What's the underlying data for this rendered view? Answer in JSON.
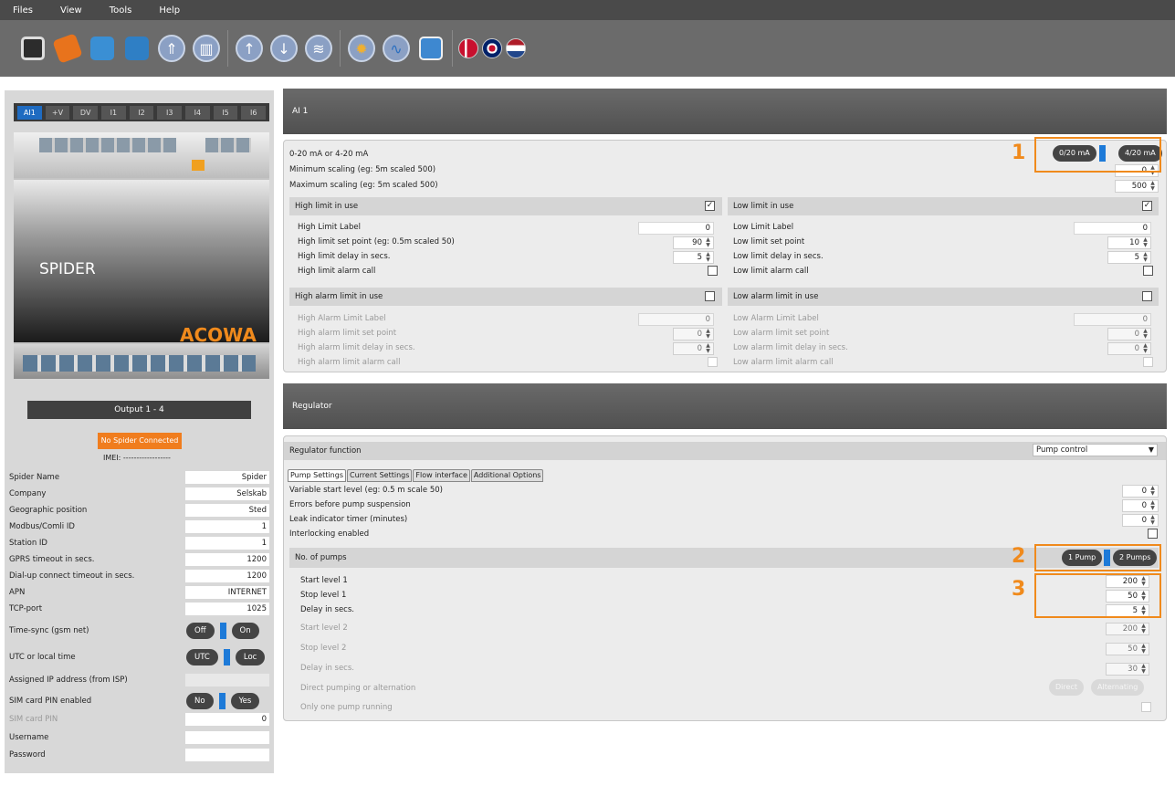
{
  "menu": [
    "Files",
    "View",
    "Tools",
    "Help"
  ],
  "ai_tabs": [
    "AI1",
    "+V",
    "DV",
    "I1",
    "I2",
    "I3",
    "I4",
    "I5",
    "I6"
  ],
  "device": {
    "brand": "SPIDER",
    "logo": "ACOWA"
  },
  "output_label": "Output 1 - 4",
  "status": "No Spider Connected",
  "imei": "IMEI: ------------------",
  "fields": [
    {
      "label": "Spider Name",
      "value": "Spider"
    },
    {
      "label": "Company",
      "value": "Selskab"
    },
    {
      "label": "Geographic position",
      "value": "Sted"
    },
    {
      "label": "Modbus/Comli ID",
      "value": "1"
    },
    {
      "label": "Station ID",
      "value": "1"
    },
    {
      "label": "GPRS timeout in secs.",
      "value": "1200"
    },
    {
      "label": "Dial-up connect timeout in secs.",
      "value": "1200"
    },
    {
      "label": "APN",
      "value": "INTERNET"
    },
    {
      "label": "TCP-port",
      "value": "1025"
    }
  ],
  "toggles": {
    "timesync": {
      "label": "Time-sync (gsm net)",
      "off": "Off",
      "on": "On"
    },
    "utc": {
      "label": "UTC or local time",
      "off": "UTC",
      "on": "Loc"
    },
    "assigned_ip": {
      "label": "Assigned IP address (from ISP)",
      "value": ""
    },
    "simpin": {
      "label": "SIM card PIN enabled",
      "off": "No",
      "on": "Yes"
    },
    "simcode": {
      "label": "SIM card PIN",
      "value": "0"
    },
    "username": {
      "label": "Username",
      "value": ""
    },
    "password": {
      "label": "Password",
      "value": ""
    }
  },
  "ai": {
    "header": "AI 1",
    "range_label": "0-20 mA or 4-20 mA",
    "range_off": "0/20 mA",
    "range_on": "4/20 mA",
    "min_label": "Minimum scaling (eg: 5m scaled 500)",
    "min_value": "0",
    "max_label": "Maximum scaling (eg: 5m scaled 500)",
    "max_value": "500",
    "high": {
      "title": "High limit in use",
      "label": "High Limit Label",
      "label_value": "0",
      "setpoint": "High limit set point (eg: 0.5m scaled 50)",
      "setpoint_value": "90",
      "delay": "High limit delay in secs.",
      "delay_value": "5",
      "alarm": "High limit alarm call"
    },
    "low": {
      "title": "Low limit in use",
      "label": "Low Limit Label",
      "label_value": "0",
      "setpoint": "Low limit set point",
      "setpoint_value": "10",
      "delay": "Low limit delay in secs.",
      "delay_value": "5",
      "alarm": "Low limit alarm call"
    },
    "high_alarm": {
      "title": "High alarm limit in use",
      "label": "High Alarm Limit Label",
      "label_value": "0",
      "setpoint": "High alarm limit set point",
      "setpoint_value": "0",
      "delay": "High alarm limit delay in secs.",
      "delay_value": "0",
      "alarm": "High alarm limit alarm call"
    },
    "low_alarm": {
      "title": "Low alarm limit in use",
      "label": "Low Alarm Limit Label",
      "label_value": "0",
      "setpoint": "Low alarm limit set point",
      "setpoint_value": "0",
      "delay": "Low alarm limit delay in secs.",
      "delay_value": "0",
      "alarm": "Low alarm limit alarm call"
    }
  },
  "regulator": {
    "header": "Regulator",
    "function_label": "Regulator function",
    "function_value": "Pump control",
    "tabs": [
      "Pump Settings",
      "Current Settings",
      "Flow interface",
      "Additional Options"
    ],
    "var_start": {
      "label": "Variable start level (eg: 0.5 m scale 50)",
      "value": "0"
    },
    "errors": {
      "label": "Errors before pump suspension",
      "value": "0"
    },
    "leak": {
      "label": "Leak indicator timer (minutes)",
      "value": "0"
    },
    "interlock": "Interlocking enabled",
    "pumps_label": "No. of pumps",
    "pump1": "1 Pump",
    "pump2": "2 Pumps",
    "start1": {
      "label": "Start level 1",
      "value": "200"
    },
    "stop1": {
      "label": "Stop level 1",
      "value": "50"
    },
    "delay1": {
      "label": "Delay in secs.",
      "value": "5"
    },
    "start2": {
      "label": "Start level 2",
      "value": "200"
    },
    "stop2": {
      "label": "Stop level 2",
      "value": "50"
    },
    "delay2": {
      "label": "Delay in secs.",
      "value": "30"
    },
    "direct_label": "Direct pumping or alternation",
    "direct": "Direct",
    "alternating": "Alternating",
    "one_pump": "Only one pump running"
  },
  "callouts": [
    "1",
    "2",
    "3"
  ],
  "colors": {
    "accent": "#f08a1c",
    "switch": "#1d7ad8"
  }
}
